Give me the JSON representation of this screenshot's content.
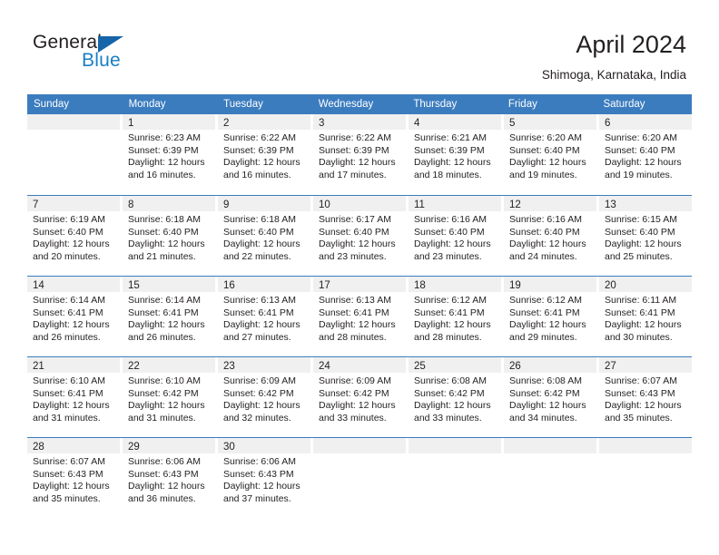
{
  "brand": {
    "name_dark": "General",
    "name_blue": "Blue",
    "triangle_icon": "triangle-icon",
    "colors": {
      "dark": "#231f20",
      "blue": "#1a7ec6",
      "triangle": "#1565a8"
    }
  },
  "header": {
    "title": "April 2024",
    "subtitle": "Shimoga, Karnataka, India"
  },
  "calendar": {
    "accent_color": "#3b7cbf",
    "daynum_band_color": "#f0f0f0",
    "weekday_headers": [
      "Sunday",
      "Monday",
      "Tuesday",
      "Wednesday",
      "Thursday",
      "Friday",
      "Saturday"
    ],
    "weeks": [
      [
        {
          "day": "",
          "lines": []
        },
        {
          "day": "1",
          "lines": [
            "Sunrise: 6:23 AM",
            "Sunset: 6:39 PM",
            "Daylight: 12 hours",
            "and 16 minutes."
          ]
        },
        {
          "day": "2",
          "lines": [
            "Sunrise: 6:22 AM",
            "Sunset: 6:39 PM",
            "Daylight: 12 hours",
            "and 16 minutes."
          ]
        },
        {
          "day": "3",
          "lines": [
            "Sunrise: 6:22 AM",
            "Sunset: 6:39 PM",
            "Daylight: 12 hours",
            "and 17 minutes."
          ]
        },
        {
          "day": "4",
          "lines": [
            "Sunrise: 6:21 AM",
            "Sunset: 6:39 PM",
            "Daylight: 12 hours",
            "and 18 minutes."
          ]
        },
        {
          "day": "5",
          "lines": [
            "Sunrise: 6:20 AM",
            "Sunset: 6:40 PM",
            "Daylight: 12 hours",
            "and 19 minutes."
          ]
        },
        {
          "day": "6",
          "lines": [
            "Sunrise: 6:20 AM",
            "Sunset: 6:40 PM",
            "Daylight: 12 hours",
            "and 19 minutes."
          ]
        }
      ],
      [
        {
          "day": "7",
          "lines": [
            "Sunrise: 6:19 AM",
            "Sunset: 6:40 PM",
            "Daylight: 12 hours",
            "and 20 minutes."
          ]
        },
        {
          "day": "8",
          "lines": [
            "Sunrise: 6:18 AM",
            "Sunset: 6:40 PM",
            "Daylight: 12 hours",
            "and 21 minutes."
          ]
        },
        {
          "day": "9",
          "lines": [
            "Sunrise: 6:18 AM",
            "Sunset: 6:40 PM",
            "Daylight: 12 hours",
            "and 22 minutes."
          ]
        },
        {
          "day": "10",
          "lines": [
            "Sunrise: 6:17 AM",
            "Sunset: 6:40 PM",
            "Daylight: 12 hours",
            "and 23 minutes."
          ]
        },
        {
          "day": "11",
          "lines": [
            "Sunrise: 6:16 AM",
            "Sunset: 6:40 PM",
            "Daylight: 12 hours",
            "and 23 minutes."
          ]
        },
        {
          "day": "12",
          "lines": [
            "Sunrise: 6:16 AM",
            "Sunset: 6:40 PM",
            "Daylight: 12 hours",
            "and 24 minutes."
          ]
        },
        {
          "day": "13",
          "lines": [
            "Sunrise: 6:15 AM",
            "Sunset: 6:40 PM",
            "Daylight: 12 hours",
            "and 25 minutes."
          ]
        }
      ],
      [
        {
          "day": "14",
          "lines": [
            "Sunrise: 6:14 AM",
            "Sunset: 6:41 PM",
            "Daylight: 12 hours",
            "and 26 minutes."
          ]
        },
        {
          "day": "15",
          "lines": [
            "Sunrise: 6:14 AM",
            "Sunset: 6:41 PM",
            "Daylight: 12 hours",
            "and 26 minutes."
          ]
        },
        {
          "day": "16",
          "lines": [
            "Sunrise: 6:13 AM",
            "Sunset: 6:41 PM",
            "Daylight: 12 hours",
            "and 27 minutes."
          ]
        },
        {
          "day": "17",
          "lines": [
            "Sunrise: 6:13 AM",
            "Sunset: 6:41 PM",
            "Daylight: 12 hours",
            "and 28 minutes."
          ]
        },
        {
          "day": "18",
          "lines": [
            "Sunrise: 6:12 AM",
            "Sunset: 6:41 PM",
            "Daylight: 12 hours",
            "and 28 minutes."
          ]
        },
        {
          "day": "19",
          "lines": [
            "Sunrise: 6:12 AM",
            "Sunset: 6:41 PM",
            "Daylight: 12 hours",
            "and 29 minutes."
          ]
        },
        {
          "day": "20",
          "lines": [
            "Sunrise: 6:11 AM",
            "Sunset: 6:41 PM",
            "Daylight: 12 hours",
            "and 30 minutes."
          ]
        }
      ],
      [
        {
          "day": "21",
          "lines": [
            "Sunrise: 6:10 AM",
            "Sunset: 6:41 PM",
            "Daylight: 12 hours",
            "and 31 minutes."
          ]
        },
        {
          "day": "22",
          "lines": [
            "Sunrise: 6:10 AM",
            "Sunset: 6:42 PM",
            "Daylight: 12 hours",
            "and 31 minutes."
          ]
        },
        {
          "day": "23",
          "lines": [
            "Sunrise: 6:09 AM",
            "Sunset: 6:42 PM",
            "Daylight: 12 hours",
            "and 32 minutes."
          ]
        },
        {
          "day": "24",
          "lines": [
            "Sunrise: 6:09 AM",
            "Sunset: 6:42 PM",
            "Daylight: 12 hours",
            "and 33 minutes."
          ]
        },
        {
          "day": "25",
          "lines": [
            "Sunrise: 6:08 AM",
            "Sunset: 6:42 PM",
            "Daylight: 12 hours",
            "and 33 minutes."
          ]
        },
        {
          "day": "26",
          "lines": [
            "Sunrise: 6:08 AM",
            "Sunset: 6:42 PM",
            "Daylight: 12 hours",
            "and 34 minutes."
          ]
        },
        {
          "day": "27",
          "lines": [
            "Sunrise: 6:07 AM",
            "Sunset: 6:43 PM",
            "Daylight: 12 hours",
            "and 35 minutes."
          ]
        }
      ],
      [
        {
          "day": "28",
          "lines": [
            "Sunrise: 6:07 AM",
            "Sunset: 6:43 PM",
            "Daylight: 12 hours",
            "and 35 minutes."
          ]
        },
        {
          "day": "29",
          "lines": [
            "Sunrise: 6:06 AM",
            "Sunset: 6:43 PM",
            "Daylight: 12 hours",
            "and 36 minutes."
          ]
        },
        {
          "day": "30",
          "lines": [
            "Sunrise: 6:06 AM",
            "Sunset: 6:43 PM",
            "Daylight: 12 hours",
            "and 37 minutes."
          ]
        },
        {
          "day": "",
          "lines": []
        },
        {
          "day": "",
          "lines": []
        },
        {
          "day": "",
          "lines": []
        },
        {
          "day": "",
          "lines": []
        }
      ]
    ]
  }
}
